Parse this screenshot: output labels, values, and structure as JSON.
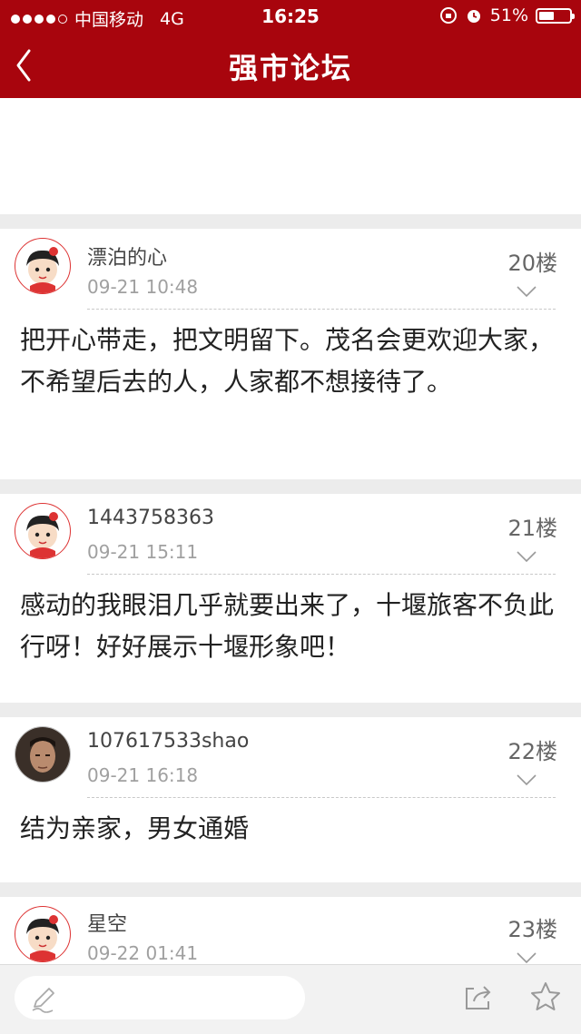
{
  "status_bar": {
    "carrier": "中国移动",
    "network": "4G",
    "time": "16:25",
    "battery": "51%",
    "battery_level": 0.51
  },
  "header": {
    "title": "强市论坛"
  },
  "posts": [
    {
      "username": "漂泊的心",
      "time": "09-21 10:48",
      "floor": "20楼",
      "content": "把开心带走，把文明留下。茂名会更欢迎大家，不希望后去的人，人家都不想接待了。"
    },
    {
      "username": "1443758363",
      "time": "09-21 15:11",
      "floor": "21楼",
      "content": "感动的我眼泪几乎就要出来了，十堰旅客不负此行呀！好好展示十堰形象吧！"
    },
    {
      "username": "107617533shao",
      "time": "09-21 16:18",
      "floor": "22楼",
      "content": "结为亲家，男女通婚"
    },
    {
      "username": "星空",
      "time": "09-22 01:41",
      "floor": "23楼",
      "content": ""
    }
  ],
  "colors": {
    "brand": "#a8050d",
    "page_bg": "#ececec",
    "muted_text": "#a0a0a0"
  },
  "icons": {
    "back": "chevron-left-icon",
    "pencil": "pencil-icon",
    "share": "share-icon",
    "star": "star-icon"
  }
}
